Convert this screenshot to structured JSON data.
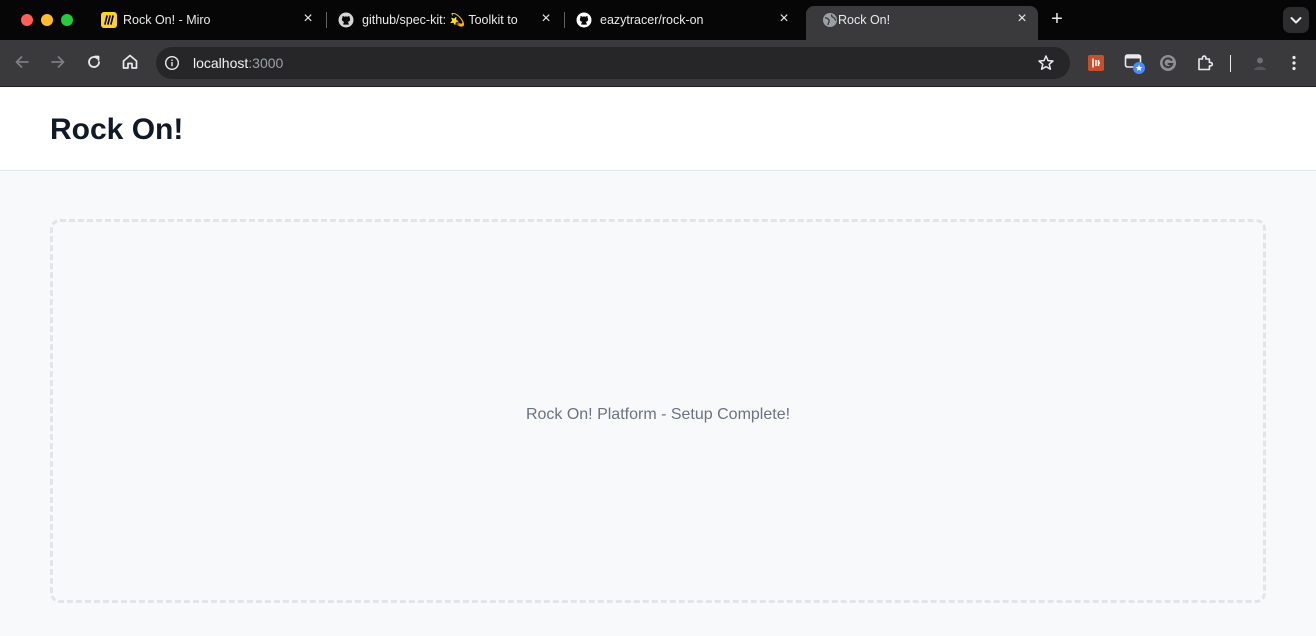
{
  "browser": {
    "tabs": [
      {
        "title": "Rock On! - Miro",
        "favicon": "miro-icon"
      },
      {
        "title": "github/spec-kit: 💫 Toolkit to",
        "favicon": "github-icon"
      },
      {
        "title": "eazytracer/rock-on",
        "favicon": "github-icon"
      },
      {
        "title": "Rock On!",
        "favicon": "globe-icon"
      }
    ],
    "active_tab": 3,
    "address": {
      "host": "localhost",
      "port": ":3000"
    }
  },
  "page": {
    "title": "Rock On!",
    "status_message": "Rock On! Platform - Setup Complete!"
  },
  "colors": {
    "title": "#111827",
    "message": "#6b7280",
    "page_background": "#f8f9fb",
    "dashed_border": "#e2e4e8"
  }
}
